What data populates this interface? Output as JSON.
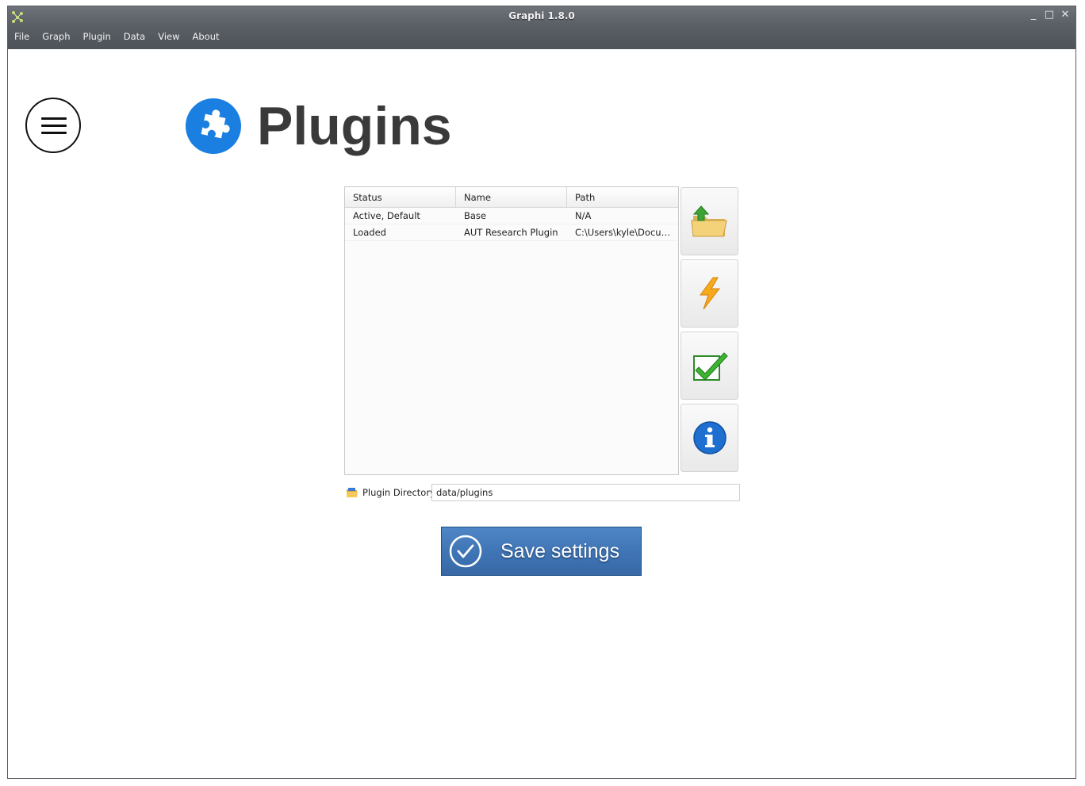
{
  "window": {
    "title": "Graphi 1.8.0",
    "controls": [
      "_",
      "□",
      "✕"
    ]
  },
  "menu": {
    "items": [
      "File",
      "Graph",
      "Plugin",
      "Data",
      "View",
      "About"
    ]
  },
  "page": {
    "title": "Plugins",
    "icon": "puzzle-icon",
    "accent": "#1a7fe0"
  },
  "table": {
    "columns": [
      "Status",
      "Name",
      "Path"
    ],
    "rows": [
      [
        "Active, Default",
        "Base",
        "N/A"
      ],
      [
        "Loaded",
        "AUT Research Plugin",
        "C:\\Users\\kyle\\Documents"
      ]
    ]
  },
  "actions": [
    "import-folder-icon",
    "lightning-icon",
    "checkmark-icon",
    "info-icon"
  ],
  "directory": {
    "label": "Plugin Directory",
    "value": "data/plugins"
  },
  "save": {
    "label": "Save settings",
    "color": "#3f74b4"
  }
}
